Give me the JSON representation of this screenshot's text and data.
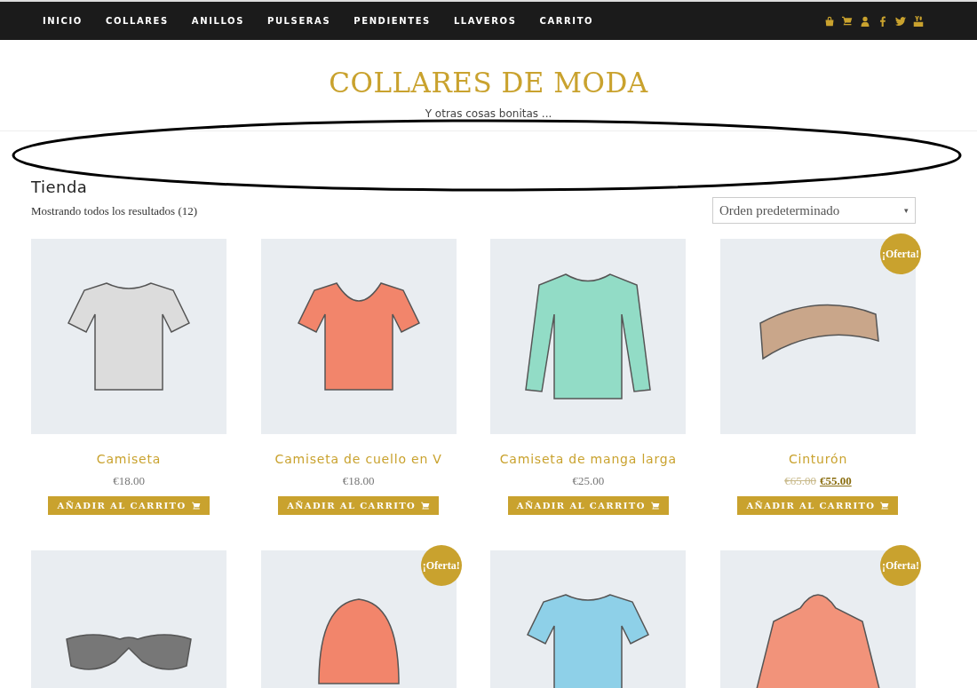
{
  "nav": {
    "items": [
      "INICIO",
      "COLLARES",
      "ANILLOS",
      "PULSERAS",
      "PENDIENTES",
      "LLAVEROS",
      "CARRITO"
    ]
  },
  "site": {
    "title": "COLLARES DE MODA",
    "tagline": "Y otras cosas bonitas ..."
  },
  "shop": {
    "heading": "Tienda",
    "result_count": "Mostrando todos los resultados (12)",
    "ordering": "Orden predeterminado",
    "ordering_arrow": "▾"
  },
  "products": [
    {
      "kind": "tshirt",
      "color": "#dcdcdc",
      "name": "Camiseta",
      "price": "€18.00",
      "button": "AÑADIR AL CARRITO",
      "sale": false
    },
    {
      "kind": "vneck",
      "color": "#f2856b",
      "name": "Camiseta de cuello en V",
      "price": "€18.00",
      "button": "AÑADIR AL CARRITO",
      "sale": false
    },
    {
      "kind": "longsleeve",
      "color": "#92dcc6",
      "name": "Camiseta de manga larga",
      "price": "€25.00",
      "button": "AÑADIR AL CARRITO",
      "sale": false
    },
    {
      "kind": "belt",
      "color": "#c9a68a",
      "name": "Cinturón",
      "old_price": "€65.00",
      "price": "€55.00",
      "button": "AÑADIR AL CARRITO",
      "sale": true,
      "badge": "¡Oferta!"
    },
    {
      "kind": "glasses",
      "color": "#777777",
      "sale": false
    },
    {
      "kind": "beanie",
      "color": "#f2856b",
      "sale": true,
      "badge": "¡Oferta!"
    },
    {
      "kind": "polo",
      "color": "#8ed0e8",
      "sale": false
    },
    {
      "kind": "hoodie",
      "color": "#f2937a",
      "sale": true,
      "badge": "¡Oferta!"
    }
  ]
}
